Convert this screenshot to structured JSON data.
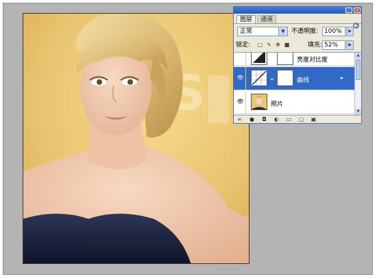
{
  "layers_panel": {
    "tabs": [
      "图层",
      "通道"
    ],
    "blend_mode": "正常",
    "opacity_label": "不透明度:",
    "opacity_value": "100%",
    "lock_label": "锁定:",
    "fill_label": "填充:",
    "fill_value": "52%",
    "layers": [
      {
        "name": "亮度对比度",
        "visible": false,
        "selected": false
      },
      {
        "name": "曲线",
        "visible": true,
        "selected": true
      },
      {
        "name": "照片",
        "visible": true,
        "selected": false
      }
    ]
  },
  "colors": {
    "selection": "#3169c6",
    "titlebar": "#2a66d4",
    "canvas_gray": "#b4b4b4",
    "photo_background": "#f1d383"
  }
}
